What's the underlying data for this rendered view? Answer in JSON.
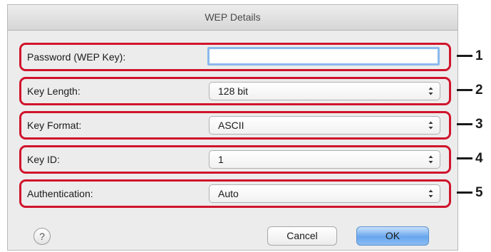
{
  "dialog": {
    "title": "WEP Details"
  },
  "fields": [
    {
      "label": "Password (WEP Key):",
      "value": "",
      "marker": "1"
    },
    {
      "label": "Key Length:",
      "value": "128 bit",
      "marker": "2"
    },
    {
      "label": "Key Format:",
      "value": "ASCII",
      "marker": "3"
    },
    {
      "label": "Key ID:",
      "value": "1",
      "marker": "4"
    },
    {
      "label": "Authentication:",
      "value": "Auto",
      "marker": "5"
    }
  ],
  "buttons": {
    "help": "?",
    "cancel": "Cancel",
    "ok": "OK"
  },
  "colors": {
    "highlight": "#d0142b",
    "default_button": "#67a6ee",
    "focus_ring": "#8bb8ec"
  }
}
